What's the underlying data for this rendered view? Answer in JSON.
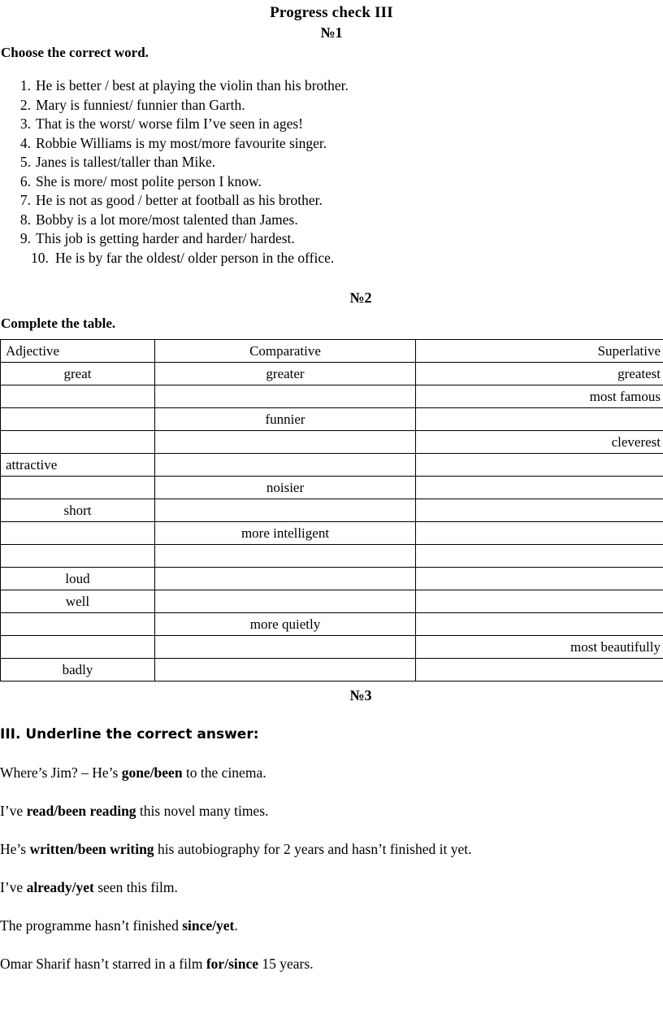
{
  "document": {
    "title": "Progress check III"
  },
  "exercise1": {
    "number_label": "№1",
    "instruction": "Choose the correct word.",
    "items": [
      {
        "num": "1.",
        "text": "He is better / best at playing the violin than his brother."
      },
      {
        "num": "2.",
        "text": "Mary is funniest/ funnier than Garth."
      },
      {
        "num": "3.",
        "text": "That is the worst/ worse film I’ve seen in ages!"
      },
      {
        "num": "4.",
        "text": "Robbie Williams is my most/more favourite singer."
      },
      {
        "num": "5.",
        "text": "Janes is tallest/taller than Mike."
      },
      {
        "num": "6.",
        "text": "She is more/ most polite person I know."
      },
      {
        "num": "7.",
        "text": "He is not as good / better  at football as his brother."
      },
      {
        "num": "8.",
        "text": "Bobby is a lot more/most talented than James."
      },
      {
        "num": "9.",
        "text": " This job is getting harder and harder/ hardest."
      },
      {
        "num": "10.",
        "text": " He is by far the oldest/ older person in the office."
      }
    ]
  },
  "exercise2": {
    "number_label": "№2",
    "instruction": "Complete the table.",
    "table": {
      "headers": [
        "Adjective",
        "Comparative",
        "Superlative"
      ],
      "rows": [
        {
          "adjective": "great",
          "comparative": "greater",
          "superlative": "greatest"
        },
        {
          "adjective": "",
          "comparative": "",
          "superlative": "most famous"
        },
        {
          "adjective": "",
          "comparative": "funnier",
          "superlative": ""
        },
        {
          "adjective": "",
          "comparative": "",
          "superlative": "cleverest"
        },
        {
          "adjective": "attractive",
          "comparative": "",
          "superlative": ""
        },
        {
          "adjective": "",
          "comparative": "noisier",
          "superlative": ""
        },
        {
          "adjective": "short",
          "comparative": "",
          "superlative": ""
        },
        {
          "adjective": "",
          "comparative": "more intelligent",
          "superlative": ""
        },
        {
          "adjective": "",
          "comparative": "",
          "superlative": ""
        },
        {
          "adjective": "loud",
          "comparative": "",
          "superlative": ""
        },
        {
          "adjective": "well",
          "comparative": "",
          "superlative": ""
        },
        {
          "adjective": "",
          "comparative": "more quietly",
          "superlative": ""
        },
        {
          "adjective": "",
          "comparative": "",
          "superlative": "most beautifully"
        },
        {
          "adjective": "badly",
          "comparative": "",
          "superlative": ""
        }
      ]
    }
  },
  "exercise3": {
    "number_label": "№3",
    "instruction": "III. Underline the correct answer:",
    "lines": [
      {
        "before": "Where’s Jim? – He’s ",
        "bold": "gone/been",
        "after": " to the cinema."
      },
      {
        "before": "I’ve ",
        "bold": "read/been reading",
        "after": " this novel many times."
      },
      {
        "before": "He’s ",
        "bold": "written/been writing",
        "after": " his autobiography for 2 years and hasn’t finished it yet."
      },
      {
        "before": "I’ve ",
        "bold": "already/yet",
        "after": " seen this film."
      },
      {
        "before": "The programme hasn’t finished ",
        "bold": "since/yet",
        "after": "."
      },
      {
        "before": "Omar Sharif hasn’t starred in a film ",
        "bold": "for/since",
        "after": " 15 years."
      }
    ]
  },
  "colors": {
    "page_background": "#ffffff",
    "text": "#000000",
    "table_border": "#000000"
  }
}
